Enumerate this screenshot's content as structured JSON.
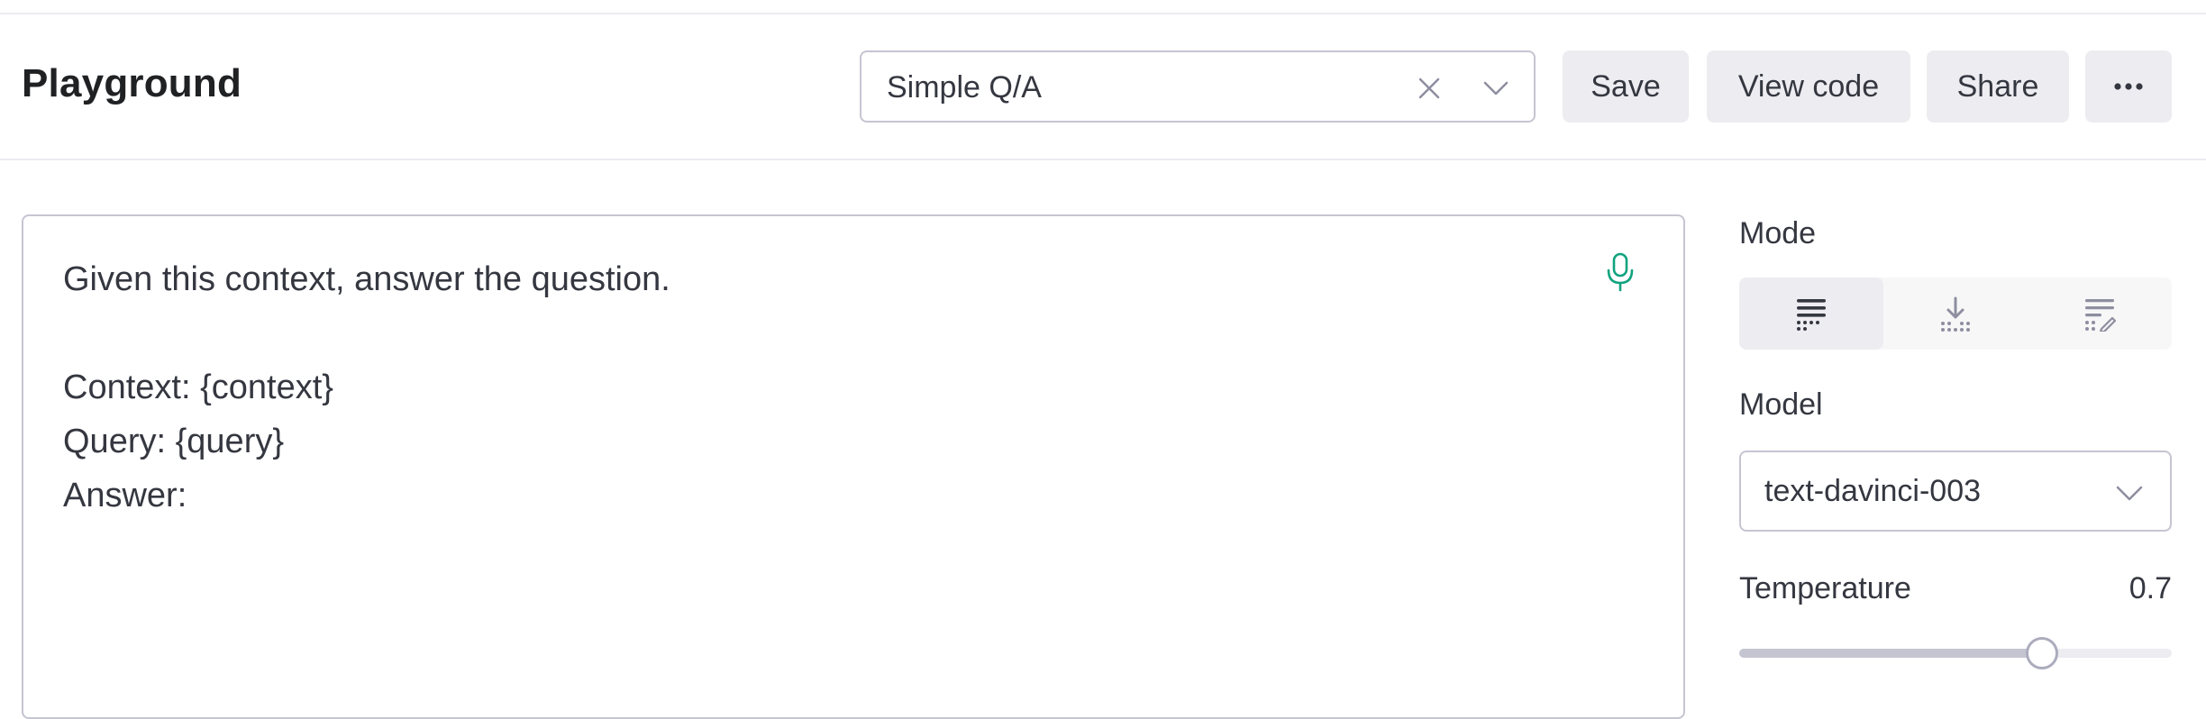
{
  "header": {
    "title": "Playground",
    "preset": {
      "value": "Simple Q/A",
      "clear_icon": "close-icon",
      "dropdown_icon": "chevron-down-icon"
    },
    "buttons": {
      "save": "Save",
      "view_code": "View code",
      "share": "Share",
      "more": "···"
    }
  },
  "prompt": {
    "text": "Given this context, answer the question.\n\nContext: {context}\nQuery: {query}\nAnswer:",
    "mic_icon": "microphone-icon",
    "mic_color": "#10a37f"
  },
  "sidebar": {
    "mode": {
      "label": "Mode",
      "options": [
        {
          "icon": "complete-mode-icon",
          "active": true
        },
        {
          "icon": "insert-mode-icon",
          "active": false
        },
        {
          "icon": "edit-mode-icon",
          "active": false
        }
      ]
    },
    "model": {
      "label": "Model",
      "value": "text-davinci-003"
    },
    "temperature": {
      "label": "Temperature",
      "value": "0.7",
      "fraction": 0.7
    }
  },
  "colors": {
    "text": "#202123",
    "button_bg": "#ececf1",
    "border": "#c5c5d2",
    "accent_green": "#10a37f"
  }
}
